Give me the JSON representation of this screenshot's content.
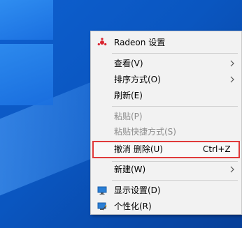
{
  "menu": {
    "items": {
      "radeon": "Radeon 设置",
      "view": "查看(V)",
      "sort": "排序方式(O)",
      "refresh": "刷新(E)",
      "paste": "粘贴(P)",
      "paste_shortcut": "粘贴快捷方式(S)",
      "undo": "撤消 删除(U)",
      "undo_shortcut": "Ctrl+Z",
      "new": "新建(W)",
      "display": "显示设置(D)",
      "personalize": "个性化(R)"
    }
  },
  "colors": {
    "highlight_border": "#e03a3a",
    "radeon_red": "#d9232e",
    "desktop_blue": "#0a56c0"
  },
  "icons": [
    "radeon-icon",
    "display-settings-icon",
    "personalize-icon",
    "chevron-right-icon"
  ]
}
